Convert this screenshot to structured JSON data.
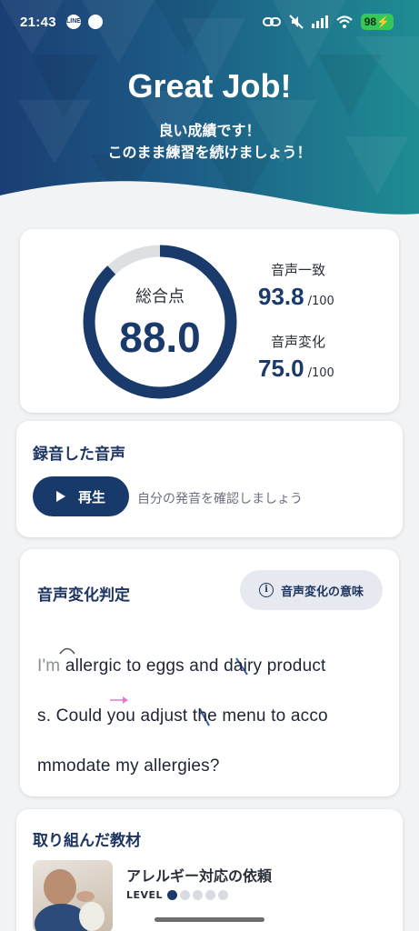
{
  "status_bar": {
    "time": "21:43",
    "battery": "98"
  },
  "header": {
    "title": "Great Job!",
    "subtitle_line1": "良い成績です！",
    "subtitle_line2": "このまま練習を続けましょう！"
  },
  "score": {
    "overall_label": "総合点",
    "overall_value": "88.0",
    "overall_fraction": 0.88,
    "match_label": "音声一致",
    "match_value": "93.8",
    "match_max": "/100",
    "change_label": "音声変化",
    "change_value": "75.0",
    "change_max": "/100"
  },
  "recording": {
    "title": "録音した音声",
    "play_label": "再生",
    "hint": "自分の発音を確認しましょう"
  },
  "judgement": {
    "title": "音声変化判定",
    "meaning_button": "音声変化の意味",
    "line1_faded": "I'm",
    "line1_rest": " allergic to eggs and dairy product",
    "line2": "s. Could you adjust the menu to acco",
    "line3": "mmodate my allergies?"
  },
  "material": {
    "title": "取り組んだ教材",
    "name": "アレルギー対応の依頼",
    "level_label": "LEVEL",
    "level": 1,
    "level_max": 5
  },
  "colors": {
    "brand_navy": "#1a3a6b",
    "ring_track": "#dedfe3",
    "accent_pink": "#e07ad0",
    "accent_blue": "#2f5fa8"
  }
}
